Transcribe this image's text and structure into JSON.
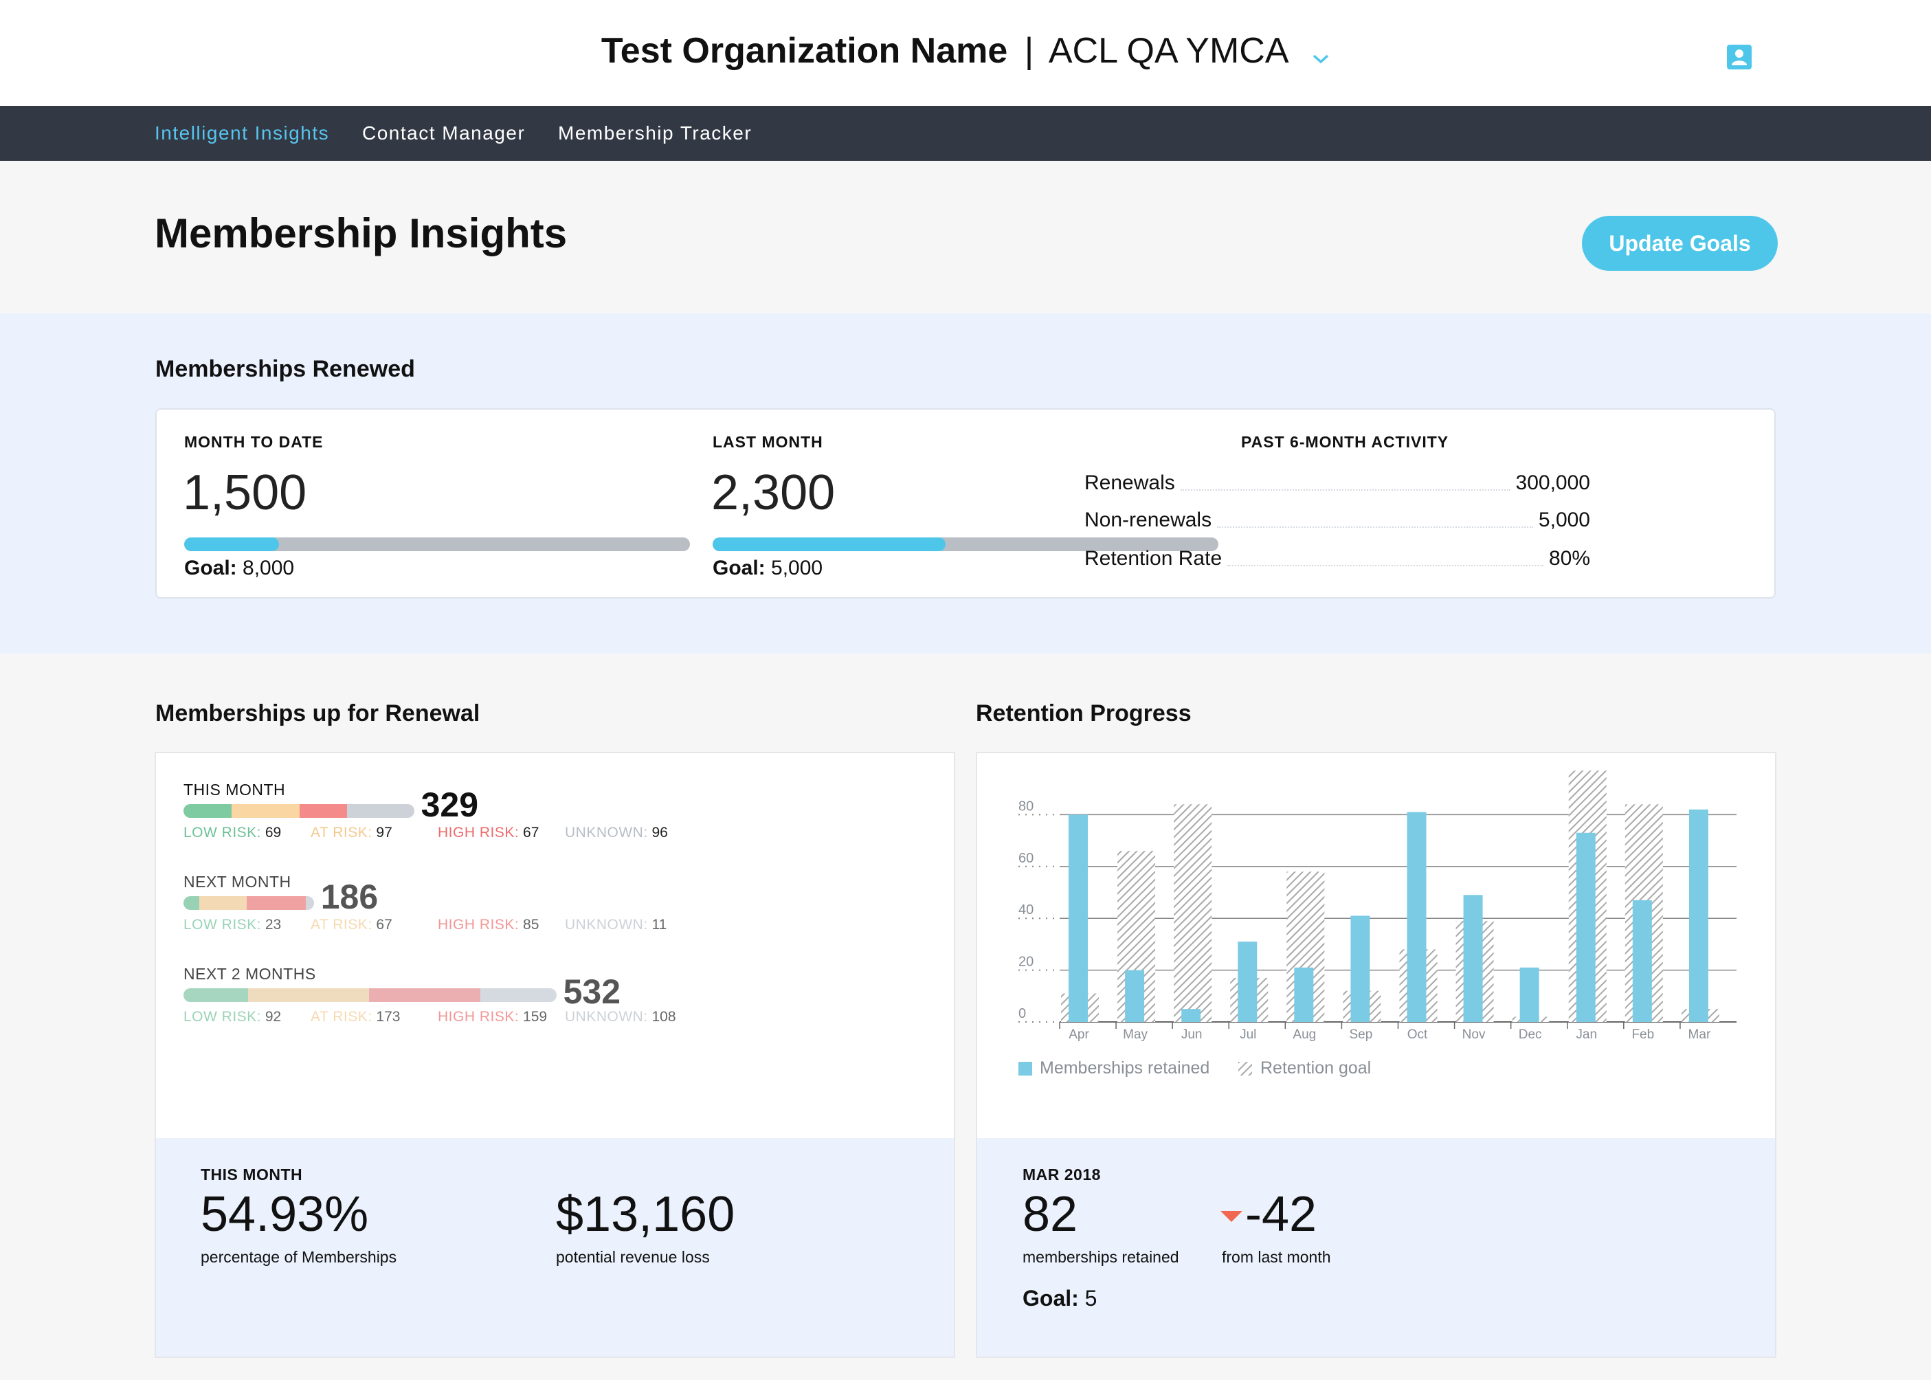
{
  "header": {
    "org_name": "Test Organization Name",
    "separator": "|",
    "branch": "ACL QA YMCA",
    "chevron_icon": "chevron-down-icon",
    "user_icon": "user-account-icon"
  },
  "nav": {
    "items": [
      {
        "label": "Intelligent Insights",
        "active": true
      },
      {
        "label": "Contact Manager",
        "active": false
      },
      {
        "label": "Membership Tracker",
        "active": false
      }
    ]
  },
  "page": {
    "title": "Membership Insights",
    "update_goals_label": "Update Goals"
  },
  "renewed": {
    "title": "Memberships Renewed",
    "month_to_date": {
      "label": "MONTH TO DATE",
      "value": "1,500",
      "goal_label": "Goal:",
      "goal_value": "8,000",
      "progress": 0.1875
    },
    "last_month": {
      "label": "LAST MONTH",
      "value": "2,300",
      "goal_label": "Goal:",
      "goal_value": "5,000",
      "progress": 0.46
    },
    "activity": {
      "label": "PAST 6-MONTH ACTIVITY",
      "rows": [
        {
          "name": "Renewals",
          "value": "300,000"
        },
        {
          "name": "Non-renewals",
          "value": "5,000"
        },
        {
          "name": "Retention Rate",
          "value": "80%"
        }
      ]
    }
  },
  "renewal": {
    "title": "Memberships up for Renewal",
    "groups": [
      {
        "label": "THIS MONTH",
        "total": "329",
        "low": 69,
        "at": 97,
        "high": 67,
        "unknown": 96
      },
      {
        "label": "NEXT MONTH",
        "total": "186",
        "low": 23,
        "at": 67,
        "high": 85,
        "unknown": 11
      },
      {
        "label": "NEXT 2 MONTHS",
        "total": "532",
        "low": 92,
        "at": 173,
        "high": 159,
        "unknown": 108
      }
    ],
    "legend": {
      "low": "LOW RISK:",
      "at": "AT RISK:",
      "high": "HIGH RISK:",
      "unknown": "UNKNOWN:"
    },
    "footer": {
      "label": "THIS MONTH",
      "percentage": "54.93%",
      "percentage_caption": "percentage of Memberships",
      "revenue": "$13,160",
      "revenue_caption": "potential revenue loss"
    }
  },
  "retention": {
    "title": "Retention Progress",
    "footer": {
      "label": "MAR 2018",
      "retained": "82",
      "retained_caption": "memberships retained",
      "change": "-42",
      "change_caption": "from last month",
      "change_icon": "triangle-down-icon",
      "goal_label": "Goal:",
      "goal_value": "5"
    }
  },
  "chart_data": {
    "type": "bar",
    "categories": [
      "Apr",
      "May",
      "Jun",
      "Jul",
      "Aug",
      "Sep",
      "Oct",
      "Nov",
      "Dec",
      "Jan",
      "Feb",
      "Mar"
    ],
    "series": [
      {
        "name": "Memberships retained",
        "values": [
          80,
          20,
          5,
          31,
          21,
          41,
          81,
          49,
          21,
          73,
          47,
          82
        ]
      },
      {
        "name": "Retention goal",
        "values": [
          11,
          66,
          84,
          17,
          58,
          12,
          28,
          39,
          2,
          97,
          84,
          5
        ]
      }
    ],
    "yticks": [
      0,
      20,
      40,
      60,
      80
    ],
    "ylim": [
      0,
      100
    ],
    "grid": true,
    "legend_position": "bottom-left"
  },
  "colors": {
    "accent": "#4ec6ea",
    "nav_bg": "#323844",
    "low_risk": "#7ecba1",
    "at_risk": "#f9d6a2",
    "high_risk": "#f48a8a",
    "unknown": "#cdd2d8",
    "bar_blue": "#7ccbe4",
    "negative": "#f2674f"
  }
}
